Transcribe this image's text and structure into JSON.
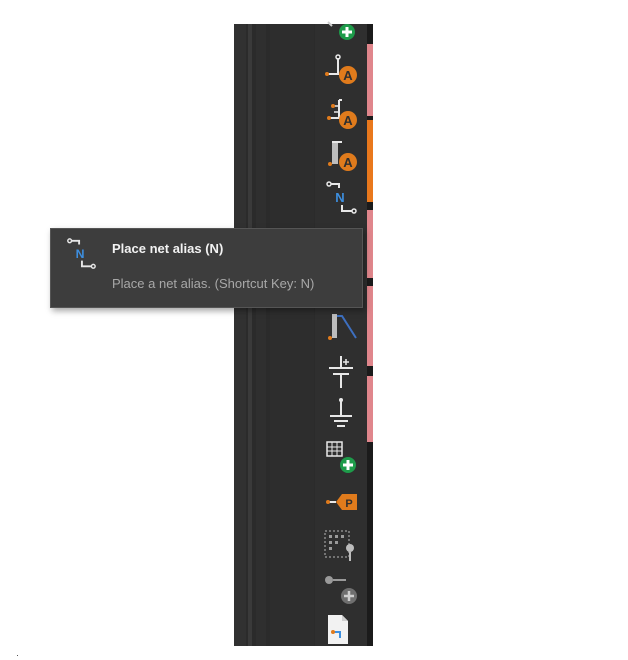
{
  "tooltip": {
    "title": "Place net alias (N)",
    "description": "Place a net alias. (Shortcut Key: N)"
  },
  "toolbar": {
    "items": [
      {
        "icon": "add-component-icon"
      },
      {
        "icon": "place-net-label-icon",
        "badge": "A"
      },
      {
        "icon": "place-bus-label-icon",
        "badge": "A"
      },
      {
        "icon": "place-power-label-icon",
        "badge": "A"
      },
      {
        "icon": "place-net-alias-icon",
        "badge": "N"
      },
      {
        "icon": "place-bus-entry-icon"
      },
      {
        "icon": "place-power-symbol-icon"
      },
      {
        "icon": "place-ground-symbol-icon"
      },
      {
        "icon": "add-frame-icon"
      },
      {
        "icon": "place-port-icon",
        "badge": "P"
      },
      {
        "icon": "place-pin-grid-icon"
      },
      {
        "icon": "add-pin-icon"
      },
      {
        "icon": "sheet-symbol-icon"
      }
    ]
  },
  "colors": {
    "panel_bg": "#2b2b2b",
    "toolbar_bg": "#2f2f2f",
    "icon_orange": "#e07b1c",
    "icon_blue": "#3d8fe0",
    "icon_green": "#1e9b4a",
    "accent_pink": "#e0868c",
    "accent_orange": "#e9781c",
    "tooltip_bg": "#3d3d3d"
  }
}
